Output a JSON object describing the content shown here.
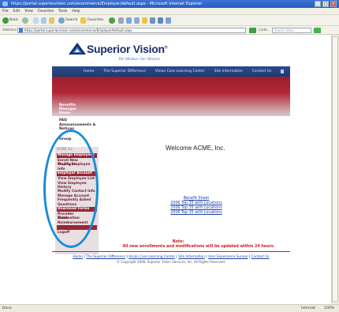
{
  "window": {
    "title": "https://portal.superiorvision.com/ecommerce/Employer/default.aspx - Microsoft Internet Explorer"
  },
  "menubar": [
    "File",
    "Edit",
    "View",
    "Favorites",
    "Tools",
    "Help"
  ],
  "toolbar": {
    "back_label": "Back",
    "search_label": "Search",
    "favorites_label": "Favorites"
  },
  "addressbar": {
    "label": "Address",
    "url": "https://portal.superiorvision.com/ecommerce/Employer/default.aspx",
    "links_label": "Links",
    "search_placeholder": "Search Sites"
  },
  "site": {
    "brand": "Superior Vision",
    "brand_mark": "®",
    "tagline": "The Mindset. Our Mission.",
    "nav": [
      "Home",
      "The Superior Difference",
      "Vision Care Learning Center",
      "Site Information",
      "Contact Us"
    ]
  },
  "sidebar": {
    "top_items": [
      "Benefits",
      "Manager",
      "Home"
    ],
    "dark_items": [
      "FAQ",
      "Announcements &",
      "Notices",
      "",
      "Group"
    ],
    "panel_label": "ACME Inc.",
    "sections": [
      {
        "type": "head",
        "label": "Manage Employees"
      },
      {
        "type": "plain",
        "label": "Enroll New Employee"
      },
      {
        "type": "plain",
        "label": "Modify Employee"
      },
      {
        "type": "plain",
        "label": "Info"
      },
      {
        "type": "head",
        "label": "Employer Account"
      },
      {
        "type": "plain",
        "label": "View Employee List"
      },
      {
        "type": "plain",
        "label": "View Employee"
      },
      {
        "type": "plain",
        "label": "History"
      },
      {
        "type": "plain",
        "label": "Modify Contact Info"
      },
      {
        "type": "plain",
        "label": "Manage Account"
      },
      {
        "type": "plain",
        "label": "Frequently Asked"
      },
      {
        "type": "plain",
        "label": "Questions"
      },
      {
        "type": "head",
        "label": "Download Forms"
      },
      {
        "type": "plain",
        "label": "Provider Nomination"
      },
      {
        "type": "plain",
        "label": "Claim"
      },
      {
        "type": "plain",
        "label": "Reimbursement"
      },
      {
        "type": "head",
        "label": ""
      },
      {
        "type": "plain",
        "label": "Logoff"
      }
    ]
  },
  "main": {
    "welcome": "Welcome ACME, Inc.",
    "links": [
      "Benefit Sheet",
      "2006 Top 35 with Locations",
      "2006 Top 35 with Locations",
      "2006 Top 35 with Locations"
    ]
  },
  "note": {
    "title": "Note:",
    "text": "All new enrollments and modifications will be updated within 24 hours."
  },
  "footer": {
    "links": [
      "Home",
      "The Superior Difference",
      "Vision Care Learning Center",
      "Site Information",
      "User Experience Survey",
      "Contact Us"
    ],
    "copyright": "© Copyright 2006, Superior Vision Services, Inc. All Rights Reserved."
  },
  "status": {
    "left": "Done",
    "zone": "Internet",
    "zoom": "100%"
  },
  "colors": {
    "nav_blue": "#1d3a74",
    "brand_red": "#b22636",
    "link_blue": "#1f3fa8",
    "highlight_oval": "#1a8dd6",
    "note_red": "#cc1c1c"
  }
}
